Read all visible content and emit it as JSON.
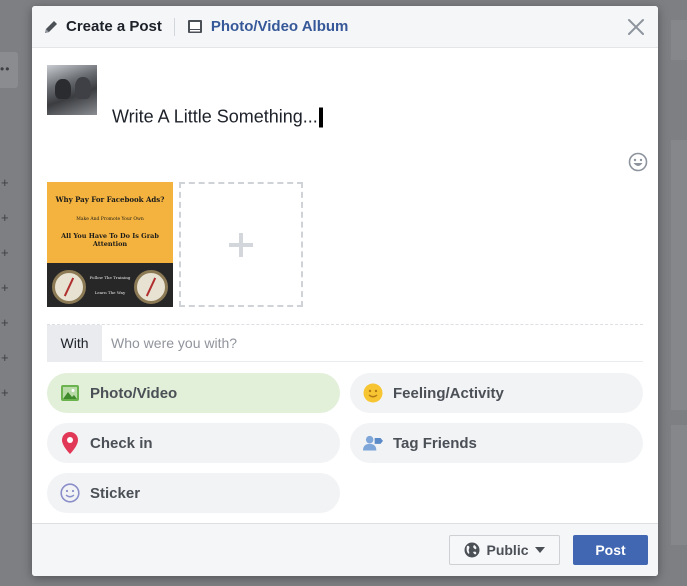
{
  "header": {
    "create_post_label": "Create a Post",
    "album_label": "Photo/Video Album"
  },
  "composer": {
    "text": "Write A Little Something..."
  },
  "attachment": {
    "ad_title": "Why Pay For Facebook Ads?",
    "ad_subtitle": "Make And Promote Your Own",
    "ad_headline": "All You Have To Do Is Grab Attention",
    "ad_line1": "Follow The Training",
    "ad_line2": "Learn The Way"
  },
  "with": {
    "label": "With",
    "placeholder": "Who were you with?"
  },
  "actions": {
    "photo_video": "Photo/Video",
    "feeling_activity": "Feeling/Activity",
    "check_in": "Check in",
    "tag_friends": "Tag Friends",
    "sticker": "Sticker"
  },
  "footer": {
    "privacy_label": "Public",
    "post_label": "Post"
  },
  "colors": {
    "brand_blue": "#4267b2",
    "album_link": "#365899",
    "photo_active_bg": "#e2efd9"
  }
}
